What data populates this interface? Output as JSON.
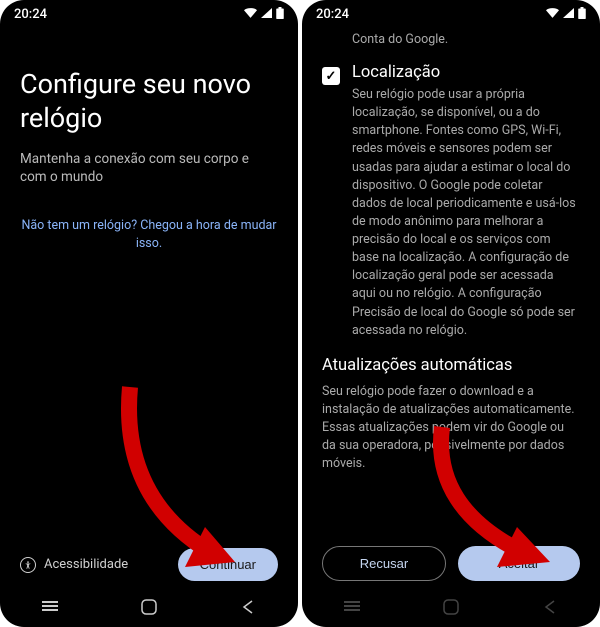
{
  "status": {
    "time": "20:24"
  },
  "left": {
    "title": "Configure seu novo relógio",
    "subtitle": "Mantenha a conexão com seu corpo e com o mundo",
    "link": "Não tem um relógio? Chegou a hora de mudar isso.",
    "accessibility": "Acessibilidade",
    "continue": "Continuar"
  },
  "right": {
    "top_fragment": "Conta do Google.",
    "location": {
      "title": "Localização",
      "body": "Seu relógio pode usar a própria localização, se disponível, ou a do smartphone. Fontes como GPS, Wi-Fi, redes móveis e sensores podem ser usadas para ajudar a estimar o local do dispositivo. O Google pode coletar dados de local periodicamente e usá-los de modo anônimo para melhorar a precisão do local e os serviços com base na localização. A configuração de localização geral pode ser acessada aqui ou no relógio. A configuração Precisão de local do Google só pode ser acessada no relógio."
    },
    "updates": {
      "title": "Atualizações automáticas",
      "body": "Seu relógio pode fazer o download e a instalação de atualizações automaticamente. Essas atualizações podem vir do Google ou da sua operadora, possivelmente por dados móveis."
    },
    "decline": "Recusar",
    "accept": "Aceitar"
  }
}
